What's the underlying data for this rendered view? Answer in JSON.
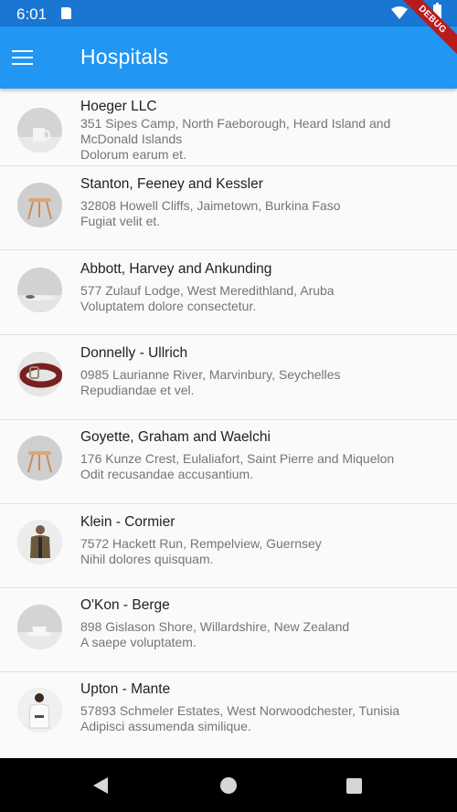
{
  "status_bar": {
    "time": "6:01"
  },
  "debug_banner": "DEBUG",
  "app_bar": {
    "title": "Hospitals",
    "menu_icon": "hamburger-menu-icon"
  },
  "hospitals": [
    {
      "name": "Hoeger LLC",
      "address": "351 Sipes Camp, North Faeborough, Heard Island and McDonald Islands",
      "description": "Dolorum earum et.",
      "avatar": "mug-image"
    },
    {
      "name": "Stanton, Feeney and Kessler",
      "address": "32808 Howell Cliffs, Jaimetown, Burkina Faso",
      "description": "Fugiat velit et.",
      "avatar": "stool-image"
    },
    {
      "name": "Abbott, Harvey and Ankunding",
      "address": "577 Zulauf Lodge, West Meredithland, Aruba",
      "description": "Voluptatem dolore consectetur.",
      "avatar": "plate-image"
    },
    {
      "name": "Donnelly - Ullrich",
      "address": "0985 Laurianne River, Marvinbury, Seychelles",
      "description": "Repudiandae et vel.",
      "avatar": "belt-image"
    },
    {
      "name": "Goyette, Graham and Waelchi",
      "address": "176 Kunze Crest, Eulaliafort, Saint Pierre and Miquelon",
      "description": "Odit recusandae accusantium.",
      "avatar": "stool-image"
    },
    {
      "name": "Klein - Cormier",
      "address": "7572 Hackett Run, Rempelview, Guernsey",
      "description": "Nihil dolores quisquam.",
      "avatar": "man-jacket-image"
    },
    {
      "name": "O'Kon - Berge",
      "address": "898 Gislason Shore, Willardshire, New Zealand",
      "description": "A saepe voluptatem.",
      "avatar": "cup-image"
    },
    {
      "name": "Upton - Mante",
      "address": "57893 Schmeler Estates, West Norwoodchester, Tunisia",
      "description": "Adipisci assumenda similique.",
      "avatar": "man-white-shirt-image"
    }
  ],
  "nav_bar": {
    "back": "back-icon",
    "home": "home-icon",
    "recents": "recents-icon"
  }
}
